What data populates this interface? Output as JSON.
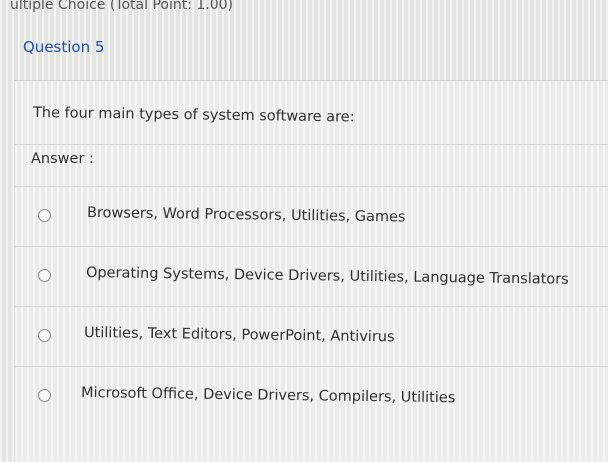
{
  "question_type": "ultiple Choice (Total Point: 1.00)",
  "question_title": "Question 5",
  "prompt": "The four main types of system software are:",
  "answer_label": "Answer :",
  "options": [
    {
      "label": "Browsers, Word Processors, Utilities, Games",
      "selected": false
    },
    {
      "label": "Operating Systems, Device Drivers, Utilities, Language Translators",
      "selected": false
    },
    {
      "label": "Utilities, Text Editors, PowerPoint, Antivirus",
      "selected": false
    },
    {
      "label": "Microsoft Office, Device Drivers, Compilers, Utilities",
      "selected": false
    }
  ],
  "colors": {
    "title": "#1f4fb0",
    "text": "#2f2f2f",
    "background": "#e4e4e2"
  }
}
